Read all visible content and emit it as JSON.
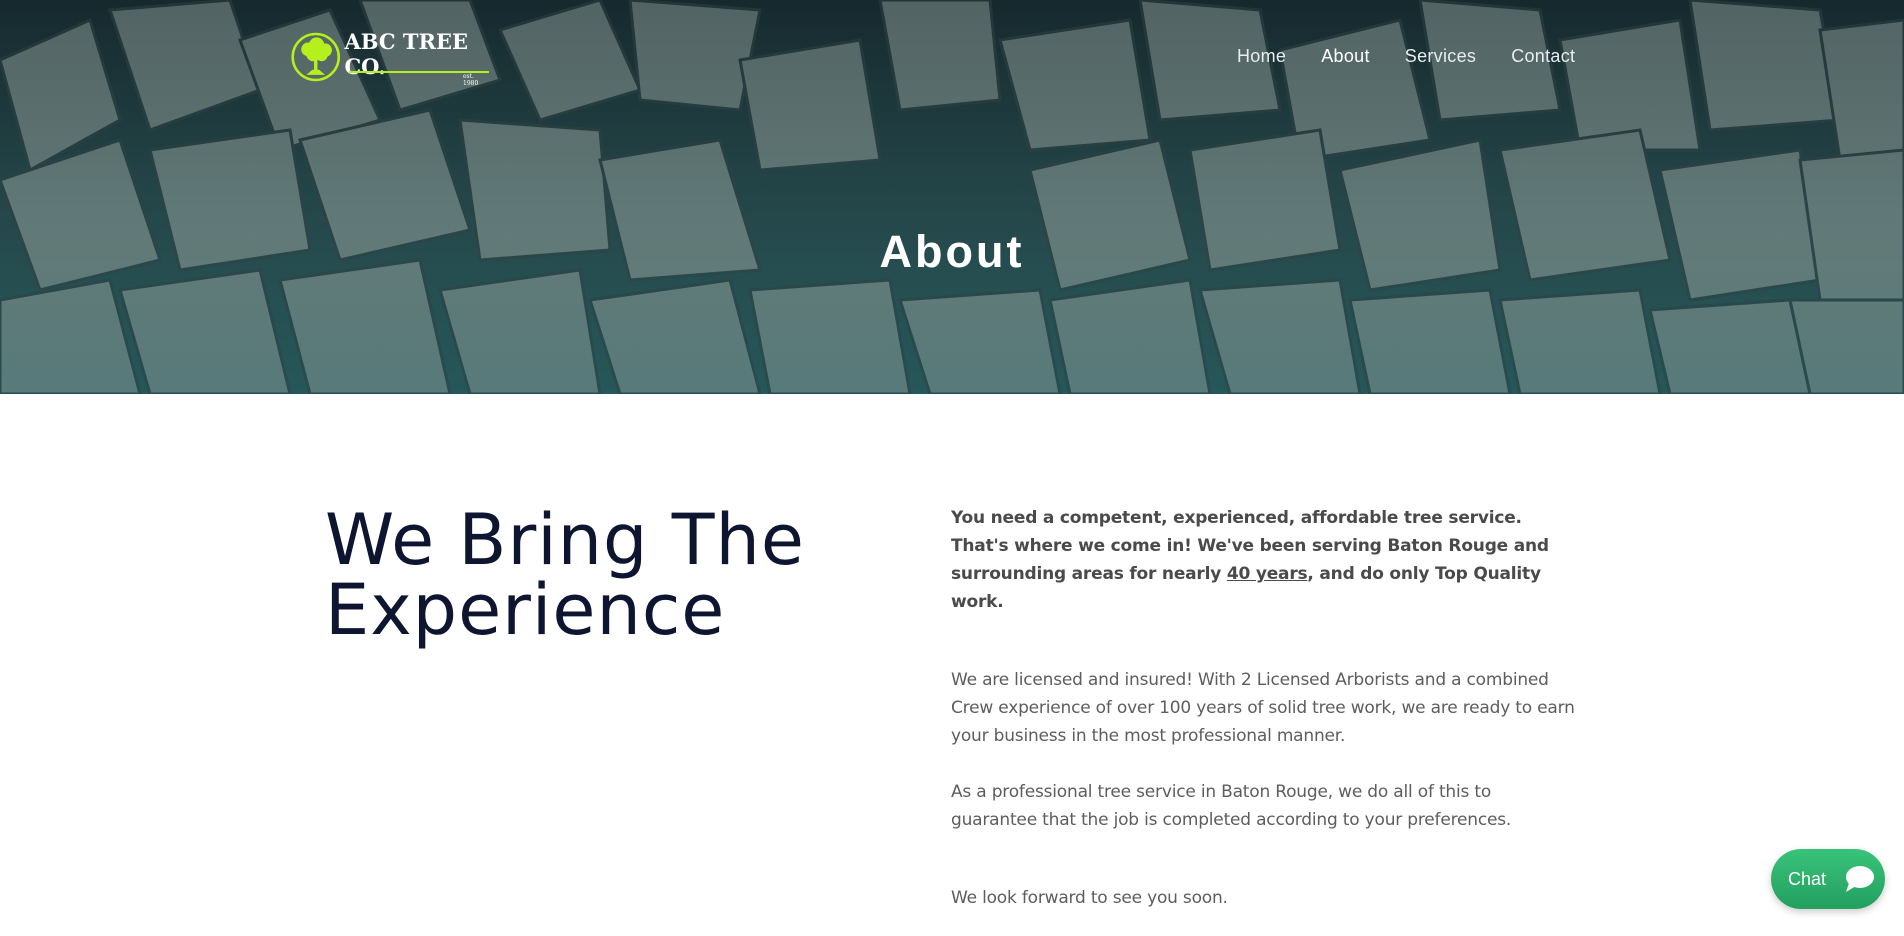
{
  "brand": {
    "name": "ABC TREE CO.",
    "est": "est. 1980",
    "accent": "#b6f01c"
  },
  "nav": {
    "items": [
      {
        "label": "Home"
      },
      {
        "label": "About"
      },
      {
        "label": "Services"
      },
      {
        "label": "Contact"
      }
    ],
    "active": "About"
  },
  "hero": {
    "title": "About"
  },
  "main": {
    "heading_line1": "We Bring The",
    "heading_line2": "Experience",
    "lead_before": "You need a competent, experienced, affordable tree service. That's where we come in!  We've been serving Baton Rouge and surrounding areas for nearly ",
    "lead_link": "40 years",
    "lead_after": ", and do only Top Quality work.",
    "para1": "We are licensed and insured! With 2 Licensed Arborists and a combined Crew experience of over 100 years of solid tree work, we are ready to earn your business in the most professional manner.",
    "para2": "As a professional tree service in Baton Rouge, we do all of this to guarantee that the job is completed according to your preferences.",
    "para3": "We look forward to see you soon."
  },
  "chat": {
    "label": "Chat",
    "color": "#2fb06b"
  }
}
